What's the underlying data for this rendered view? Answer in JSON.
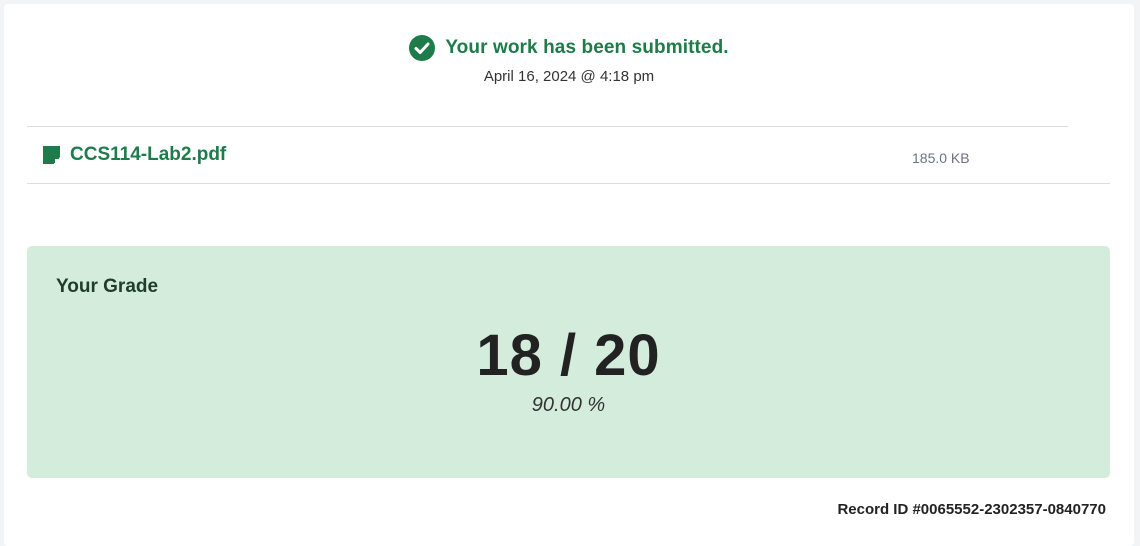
{
  "submission": {
    "status": "Your work has been submitted.",
    "date": "April 16, 2024 @ 4:18 pm",
    "icon": "check-circle-icon",
    "accent_color": "#1e7b4a"
  },
  "file": {
    "name": "CCS114-Lab2.pdf",
    "size": "185.0 KB",
    "icon": "file-icon"
  },
  "grade": {
    "label": "Your Grade",
    "score": "18 / 20",
    "percent": "90.00 %",
    "background_color": "#d4ecdc"
  },
  "record": {
    "id_text": "Record ID #0065552-2302357-0840770"
  }
}
